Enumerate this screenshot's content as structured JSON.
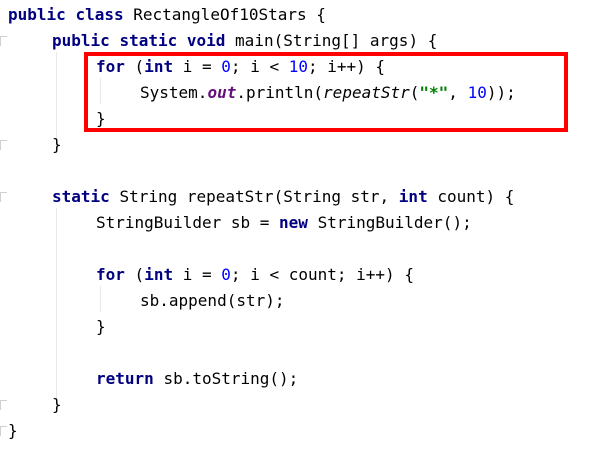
{
  "code": {
    "line1": {
      "kw1": "public",
      "kw2": "class",
      "name": "RectangleOf10Stars",
      "brace": "{"
    },
    "line2": {
      "kw1": "public",
      "kw2": "static",
      "kw3": "void",
      "sig": "main(String[] args)",
      "brace": "{"
    },
    "line3": {
      "kw_for": "for",
      "paren": "(",
      "kw_int": "int",
      "init": "i =",
      "zero": "0",
      "cond": "; i <",
      "ten": "10",
      "rest": "; i++) {"
    },
    "line4": {
      "obj": "System.",
      "field": "out",
      "call": ".println(",
      "method": "repeatStr",
      "open": "(",
      "star": "\"*\"",
      "comma": ",",
      "ten": "10",
      "close": "));"
    },
    "line5": {
      "brace": "}"
    },
    "line6": {
      "brace": "}"
    },
    "line7": {
      "kw": "static",
      "sig": "String repeatStr(String str,",
      "kw_int": "int",
      "rest": "count) {"
    },
    "line8": {
      "decl": "StringBuilder sb =",
      "kw_new": "new",
      "rest": "StringBuilder();"
    },
    "line9": {
      "kw_for": "for",
      "paren": "(",
      "kw_int": "int",
      "init": "i =",
      "zero": "0",
      "rest": "; i < count; i++) {"
    },
    "line10": {
      "stmt": "sb.append(str);"
    },
    "line11": {
      "brace": "}"
    },
    "line12": {
      "kw_return": "return",
      "rest": "sb.toString();"
    },
    "line13": {
      "brace": "}"
    },
    "line14": {
      "brace": "}"
    }
  },
  "colors": {
    "keyword": "#000080",
    "number": "#0000ff",
    "string": "#008000",
    "field": "#660e7a",
    "highlight_border": "#ff0000"
  }
}
